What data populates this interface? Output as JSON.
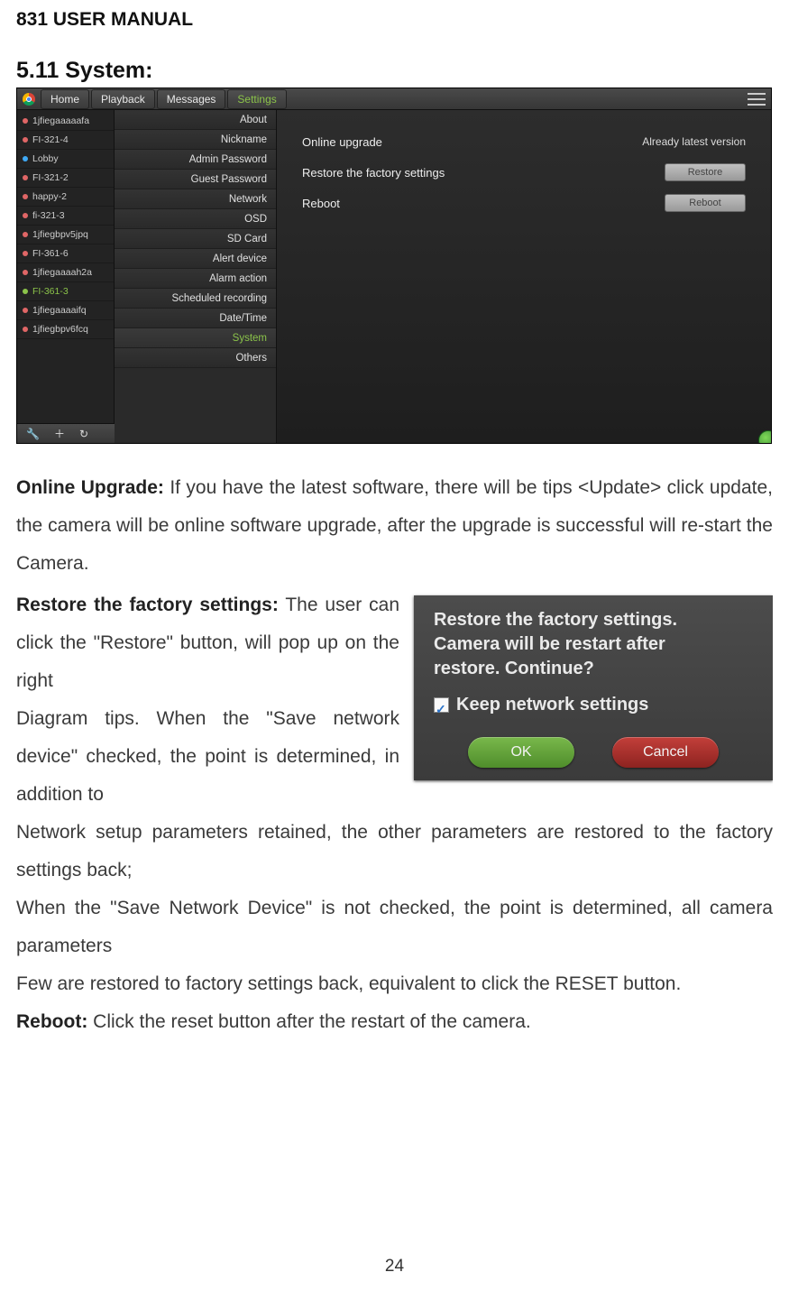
{
  "doc": {
    "header": "831 USER MANUAL",
    "section_title": "5.11 System:",
    "page_number": "24"
  },
  "shot1": {
    "nav": {
      "home": "Home",
      "playback": "Playback",
      "messages": "Messages",
      "settings": "Settings"
    },
    "devices": [
      {
        "name": "1jfiegaaaaafa",
        "color": "#e06666"
      },
      {
        "name": "FI-321-4",
        "color": "#e06666"
      },
      {
        "name": "Lobby",
        "color": "#3fa9f5"
      },
      {
        "name": "FI-321-2",
        "color": "#e06666"
      },
      {
        "name": "happy-2",
        "color": "#e06666"
      },
      {
        "name": "fi-321-3",
        "color": "#e06666"
      },
      {
        "name": "1jfiegbpv5jpq",
        "color": "#e06666"
      },
      {
        "name": "FI-361-6",
        "color": "#e06666"
      },
      {
        "name": "1jfiegaaaah2a",
        "color": "#e06666"
      },
      {
        "name": "FI-361-3",
        "color": "#8bc34a",
        "active": true
      },
      {
        "name": "1jfiegaaaaifq",
        "color": "#e06666"
      },
      {
        "name": "1jfiegbpv6fcq",
        "color": "#e06666"
      }
    ],
    "toolbar": {
      "wrench": "🔧",
      "plus": "＋",
      "refresh": "↻"
    },
    "menu": [
      "About",
      "Nickname",
      "Admin Password",
      "Guest Password",
      "Network",
      "OSD",
      "SD Card",
      "Alert device",
      "Alarm action",
      "Scheduled recording",
      "Date/Time",
      "System",
      "Others"
    ],
    "menu_active_index": 11,
    "rows": {
      "r1_label": "Online upgrade",
      "r1_right": "Already latest version",
      "r2_label": "Restore the factory settings",
      "r2_btn": "Restore",
      "r3_label": "Reboot",
      "r3_btn": "Reboot"
    }
  },
  "shot2": {
    "msg_l1": "Restore the factory settings.",
    "msg_l2": "Camera will be restart after",
    "msg_l3": "restore. Continue?",
    "keep": "Keep network settings",
    "ok": "OK",
    "cancel": "Cancel"
  },
  "text": {
    "p1_bold": "Online Upgrade:",
    "p1": " If you have the latest software, there will be tips <Update> click update, the camera will be online software upgrade, after the upgrade is successful will re-start the Camera.",
    "p2_bold": "Restore the factory settings:",
    "p2a": " The user can click the \"Restore\" button, will pop up on the right",
    "p2b": "Diagram tips. When the \"Save network device\" checked, the point is determined, in addition to",
    "p2c": "Network setup parameters retained, the other parameters are restored to the factory settings back;",
    "p3": "When the \"Save Network Device\" is not checked, the point is determined, all camera parameters",
    "p4": "Few are restored to factory settings back, equivalent to click the RESET button.",
    "p5_bold": "Reboot:",
    "p5": " Click the reset button after the restart of the camera."
  }
}
